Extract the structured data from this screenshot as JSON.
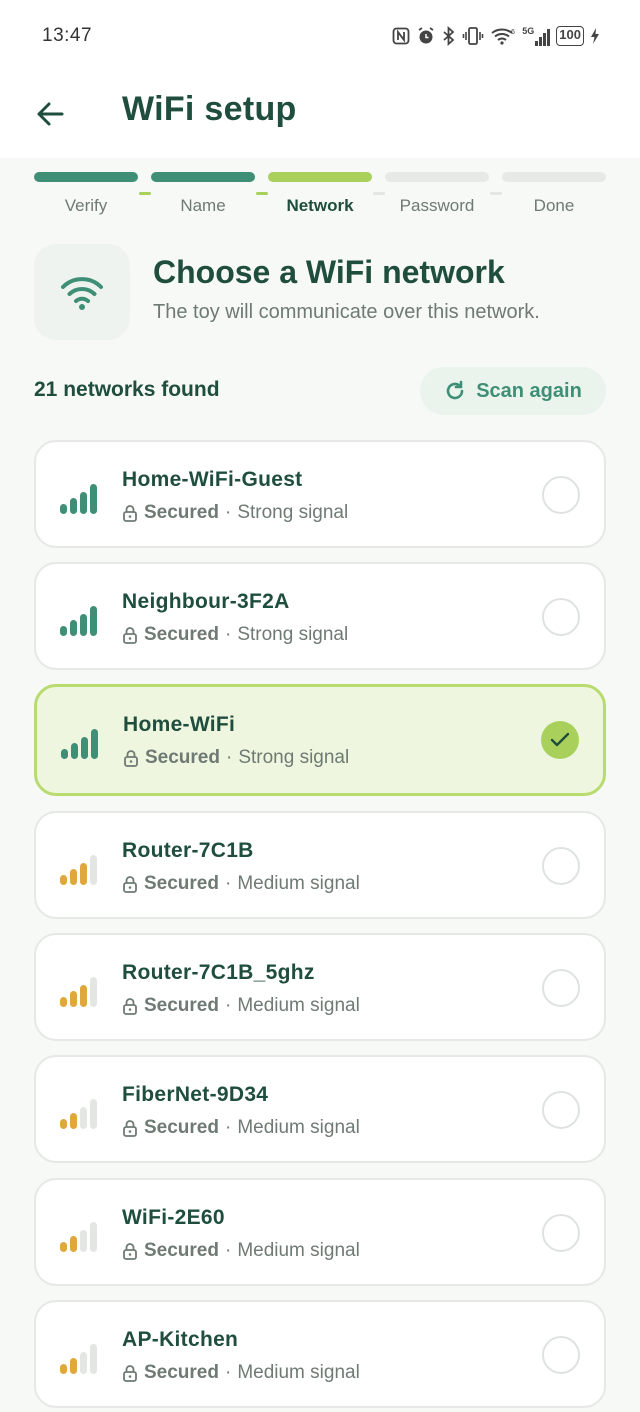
{
  "status_bar": {
    "time": "13:47",
    "network_label": "5G",
    "battery": "100"
  },
  "header": {
    "title": "WiFi setup"
  },
  "stepper": {
    "steps": [
      {
        "label": "Verify",
        "state": "done"
      },
      {
        "label": "Name",
        "state": "done"
      },
      {
        "label": "Network",
        "state": "active"
      },
      {
        "label": "Password",
        "state": "pending"
      },
      {
        "label": "Done",
        "state": "pending"
      }
    ]
  },
  "section": {
    "title": "Choose a WiFi network",
    "subtitle": "The toy will communicate over this network."
  },
  "list_header": {
    "count_text": "21 networks found",
    "scan_label": "Scan again"
  },
  "networks": [
    {
      "name": "Home-WiFi-Guest",
      "security": "Secured",
      "signal": "Strong signal",
      "strength": 4,
      "selected": false
    },
    {
      "name": "Neighbour-3F2A",
      "security": "Secured",
      "signal": "Strong signal",
      "strength": 4,
      "selected": false
    },
    {
      "name": "Home-WiFi",
      "security": "Secured",
      "signal": "Strong signal",
      "strength": 4,
      "selected": true
    },
    {
      "name": "Router-7C1B",
      "security": "Secured",
      "signal": "Medium signal",
      "strength": 3,
      "selected": false
    },
    {
      "name": "Router-7C1B_5ghz",
      "security": "Secured",
      "signal": "Medium signal",
      "strength": 3,
      "selected": false
    },
    {
      "name": "FiberNet-9D34",
      "security": "Secured",
      "signal": "Medium signal",
      "strength": 2,
      "selected": false
    },
    {
      "name": "WiFi-2E60",
      "security": "Secured",
      "signal": "Medium signal",
      "strength": 2,
      "selected": false
    },
    {
      "name": "AP-Kitchen",
      "security": "Secured",
      "signal": "Medium signal",
      "strength": 2,
      "selected": false
    }
  ],
  "colors": {
    "brand_dark": "#1f4d3e",
    "brand_green": "#3f8f76",
    "accent_lime": "#a9d05a",
    "signal_strong": "#3f8f76",
    "signal_medium": "#e0a73a",
    "signal_empty": "#e3e6e3"
  },
  "icons": {
    "back": "arrow-left-icon",
    "wifi": "wifi-icon",
    "refresh": "refresh-icon",
    "lock": "lock-icon",
    "check": "check-icon"
  }
}
